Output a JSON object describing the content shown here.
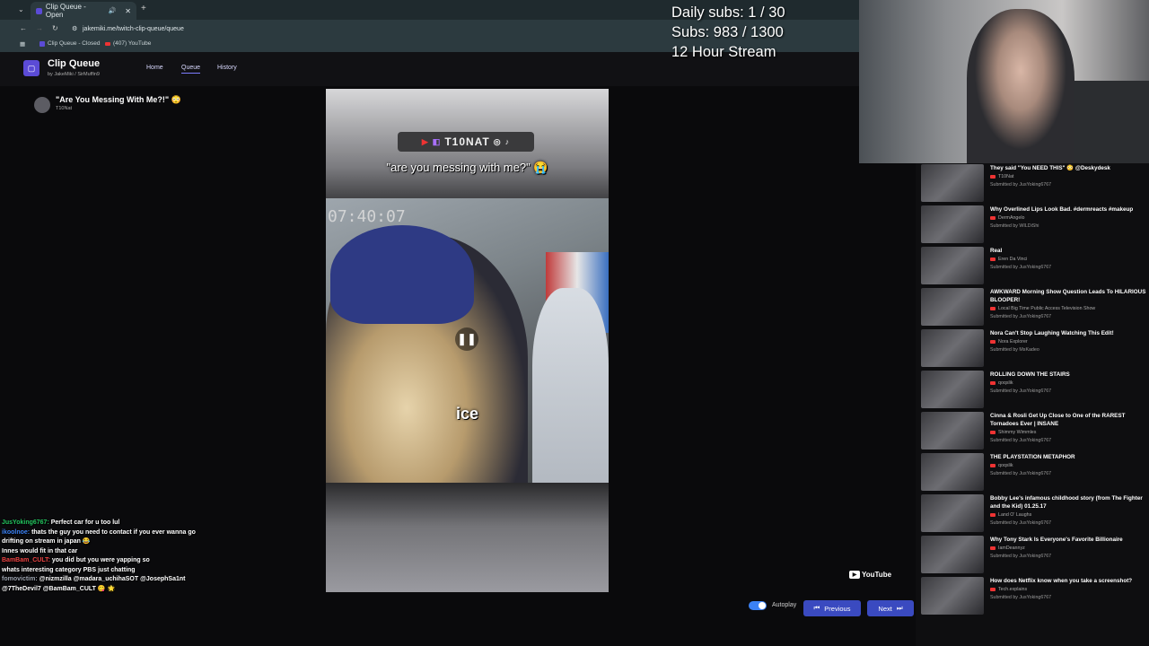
{
  "browser": {
    "tab_title": "Clip Queue - Open",
    "url": "jakemiki.me/twitch-clip-queue/queue",
    "bookmarks": [
      "Clip Queue - Closed",
      "(407) YouTube"
    ]
  },
  "app": {
    "title": "Clip Queue",
    "byline": "by JakeMiki / SirMuffin9",
    "nav": [
      "Home",
      "Queue",
      "History"
    ]
  },
  "clip": {
    "title": "\"Are You Messing With Me?!\"",
    "author": "T10Nat",
    "channel_tag": "T10NAT",
    "caption": "\"are you messing with me?\"",
    "timestamp": "07:40:07",
    "subtitle_word": "ice",
    "platform": "YouTube"
  },
  "controls": {
    "autoplay_label": "Autoplay",
    "autoplay_on": true,
    "previous_label": "Previous",
    "next_label": "Next"
  },
  "overlay": {
    "daily_subs": "Daily subs: 1 / 30",
    "subs": "Subs: 983 / 1300",
    "stream": "12 Hour Stream"
  },
  "queue": [
    {
      "title": "They said \"You NEED THIS\" 😳 @Deskydesk",
      "author": "T10Nat",
      "submitted": "Submitted by JusYoking6767"
    },
    {
      "title": "Why Overlined Lips Look Bad. #dermreacts #makeup",
      "author": "DermAngelo",
      "submitted": "Submitted by WILDiShi"
    },
    {
      "title": "Real",
      "author": "Eren Da Vinci",
      "submitted": "Submitted by JusYoking6767"
    },
    {
      "title": "AWKWARD Morning Show Question Leads To HILARIOUS BLOOPER!",
      "author": "Local Big Time Public Access Television Show",
      "submitted": "Submitted by JusYoking6767"
    },
    {
      "title": "Nora Can't Stop Laughing Watching This Edit!",
      "author": "Nora Explorer",
      "submitted": "Submitted by MsKadeo"
    },
    {
      "title": "ROLLING DOWN THE STAIRS",
      "author": "qoqslik",
      "submitted": "Submitted by JusYoking6767"
    },
    {
      "title": "Cinna & Rosli Get Up Close to One of the RAREST Tornadoes Ever | INSANE",
      "author": "Shimmy Wimmles",
      "submitted": "Submitted by JusYoking6767"
    },
    {
      "title": "THE PLAYSTATION METAPHOR",
      "author": "qoqslik",
      "submitted": "Submitted by JusYoking6767"
    },
    {
      "title": "Bobby Lee's infamous childhood story (from The Fighter and the Kid) 01.25.17",
      "author": "Land O' Laughs",
      "submitted": "Submitted by JusYoking6767"
    },
    {
      "title": "Why Tony Stark Is Everyone's Favorite Billionaire",
      "author": "IamDeannyz",
      "submitted": "Submitted by JusYoking6767"
    },
    {
      "title": "How does Netflix know when you take a screenshot?",
      "author": "Tech.explains",
      "submitted": "Submitted by JusYoking6767"
    }
  ],
  "chat": [
    {
      "user": "JusYoking6767:",
      "msg": "Perfect car for u too lul"
    },
    {
      "user": "ikoolnoe:",
      "msg": "thats the guy you need to contact if you ever wanna go drifting on stream in japan 😂"
    },
    {
      "user": "",
      "msg": "Innes would fit in that car"
    },
    {
      "user": "BamBam_CULT:",
      "msg": "you did but you were yapping so"
    },
    {
      "user": "",
      "msg": "whats interesting category PBS just chatting"
    },
    {
      "user": "fomovictim:",
      "msg": "@nizmzilla @madara_uchihaSOT @JosephSa1nt @7TheDevil7 @BamBam_CULT 😋 🌟"
    }
  ]
}
